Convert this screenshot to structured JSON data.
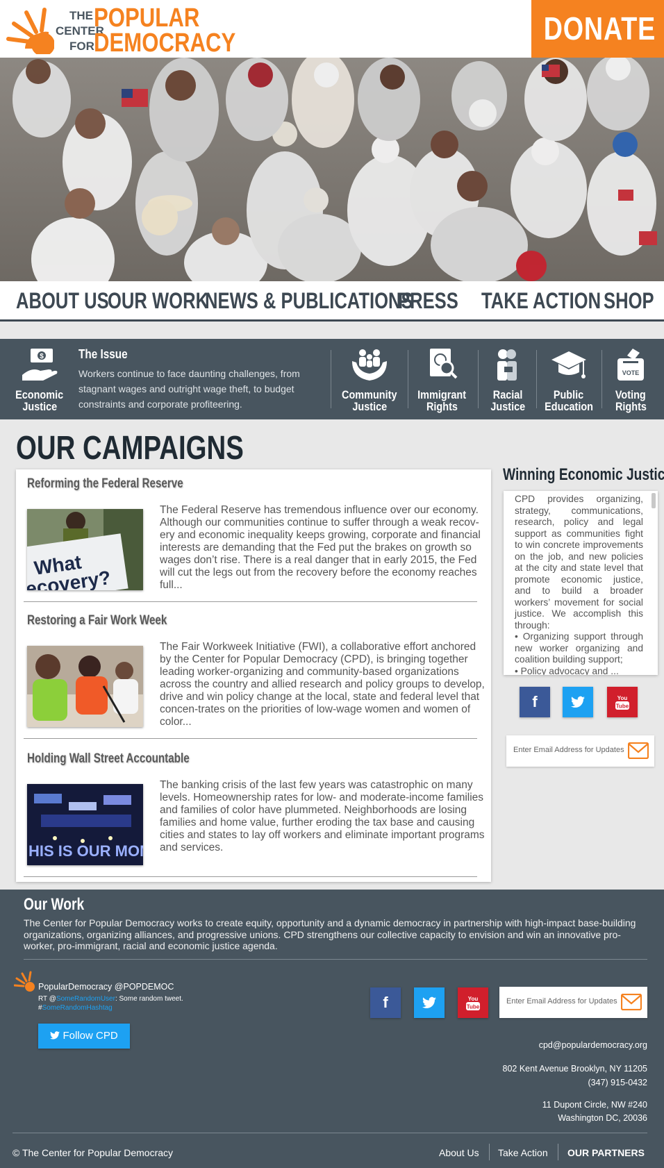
{
  "header": {
    "logo": {
      "the": "THE",
      "center": "CENTER",
      "for": "FOR",
      "popular": "POPULAR",
      "democracy": "DEMOCRACY"
    },
    "donate_label": "DONATE"
  },
  "nav": {
    "items": [
      "ABOUT US",
      "OUR WORK",
      "NEWS & PUBLICATIONS",
      "PRESS",
      "TAKE ACTION",
      "SHOP"
    ]
  },
  "issues": {
    "current": {
      "label_line1": "Economic",
      "label_line2": "Justice",
      "title": "The Issue",
      "text": "Workers continue to face daunting challenges, from stagnant wages and outright wage theft, to budget constraints and corporate profiteering."
    },
    "items": [
      {
        "line1": "Community",
        "line2": "Justice"
      },
      {
        "line1": "Immigrant",
        "line2": "Rights"
      },
      {
        "line1": "Racial",
        "line2": "Justice"
      },
      {
        "line1": "Public",
        "line2": "Education"
      },
      {
        "line1": "Voting",
        "line2": "Rights"
      }
    ]
  },
  "campaigns": {
    "title": "OUR CAMPAIGNS",
    "items": [
      {
        "title": "Reforming the Federal Reserve",
        "image_text": "What ecovery?",
        "text": "The Federal Reserve has tremendous influence over our economy. Although our communities continue to suffer through a weak recov-ery and economic inequality keeps growing, corporate and financial interests are demanding that the Fed put the brakes on growth so wages don’t rise. There is a real danger that in early 2015, the Fed will cut the legs out from the recovery before the economy reaches full..."
      },
      {
        "title": "Restoring a Fair Work Week",
        "text": "The Fair Workweek Initiative (FWI), a collaborative effort anchored by the Center for Popular Democracy (CPD), is bringing together leading worker-organizing and community-based organizations across the country and allied research and policy groups to develop, drive and win policy change at the local, state and federal level that concen-trates on the priorities of low-wage women and women of color..."
      },
      {
        "title": "Holding Wall Street Accountable",
        "image_text": "HIS IS OUR MOMEN",
        "text": "The banking crisis of the last few years was catastrophic on many levels. Homeownership rates for low- and moderate-income families and families of color have plummeted. Neighborhoods are losing families and home value, further eroding the tax base and causing cities and states to lay off workers and eliminate important programs and services."
      }
    ]
  },
  "sidebar": {
    "title": "Winning Economic Justice",
    "text": "CPD provides organizing, strategy, communications, research, policy and legal support as communities fight to win concrete improvements on the job, and new policies at the city and state level that promote economic justice, and to build a broader workers’ movement for social justice. We accomplish this through:",
    "bullet1": "• Organizing support through new worker organizing and coalition building support;",
    "bullet2": "• Policy advocacy and ...",
    "social": {
      "facebook": "f",
      "twitter": "🐦",
      "youtube": "You Tube"
    },
    "email_placeholder": "Enter Email Address for Updates"
  },
  "footer": {
    "our_work_title": "Our Work",
    "our_work_text": "The Center for Popular Democracy works to create equity, opportunity and a dynamic democracy in partnership with high-impact base-building organizations, organizing alliances, and progressive unions. CPD strengthens our collective capacity to envision and win an innovative pro-worker, pro-immigrant, racial and economic justice agenda.",
    "twitter": {
      "user": "PopularDemocracy @POPDEMOC",
      "rt_prefix": "RT @",
      "rt_user": "SomeRandomUser",
      "rt_text": ": Some random tweet.",
      "hash_prefix": "#",
      "hashtag": "SomeRandomHashtag",
      "follow_label": "Follow CPD"
    },
    "email_placeholder": "Enter Email Address for Updates",
    "email": "cpd@populardemocracy.org",
    "address1_line1": "802 Kent Avenue Brooklyn, NY 11205",
    "address1_line2": "(347) 915-0432",
    "address2_line1": "11 Dupont Circle, NW #240",
    "address2_line2": "Washington DC, 20036",
    "copyright": "© The Center for Popular Democracy",
    "links": [
      "About Us",
      "Take Action",
      "OUR PARTNERS"
    ]
  },
  "colors": {
    "accent": "#f58220",
    "dark": "#48555f",
    "facebook": "#3b5998",
    "twitter": "#1da1f2",
    "youtube": "#d11f2c"
  }
}
